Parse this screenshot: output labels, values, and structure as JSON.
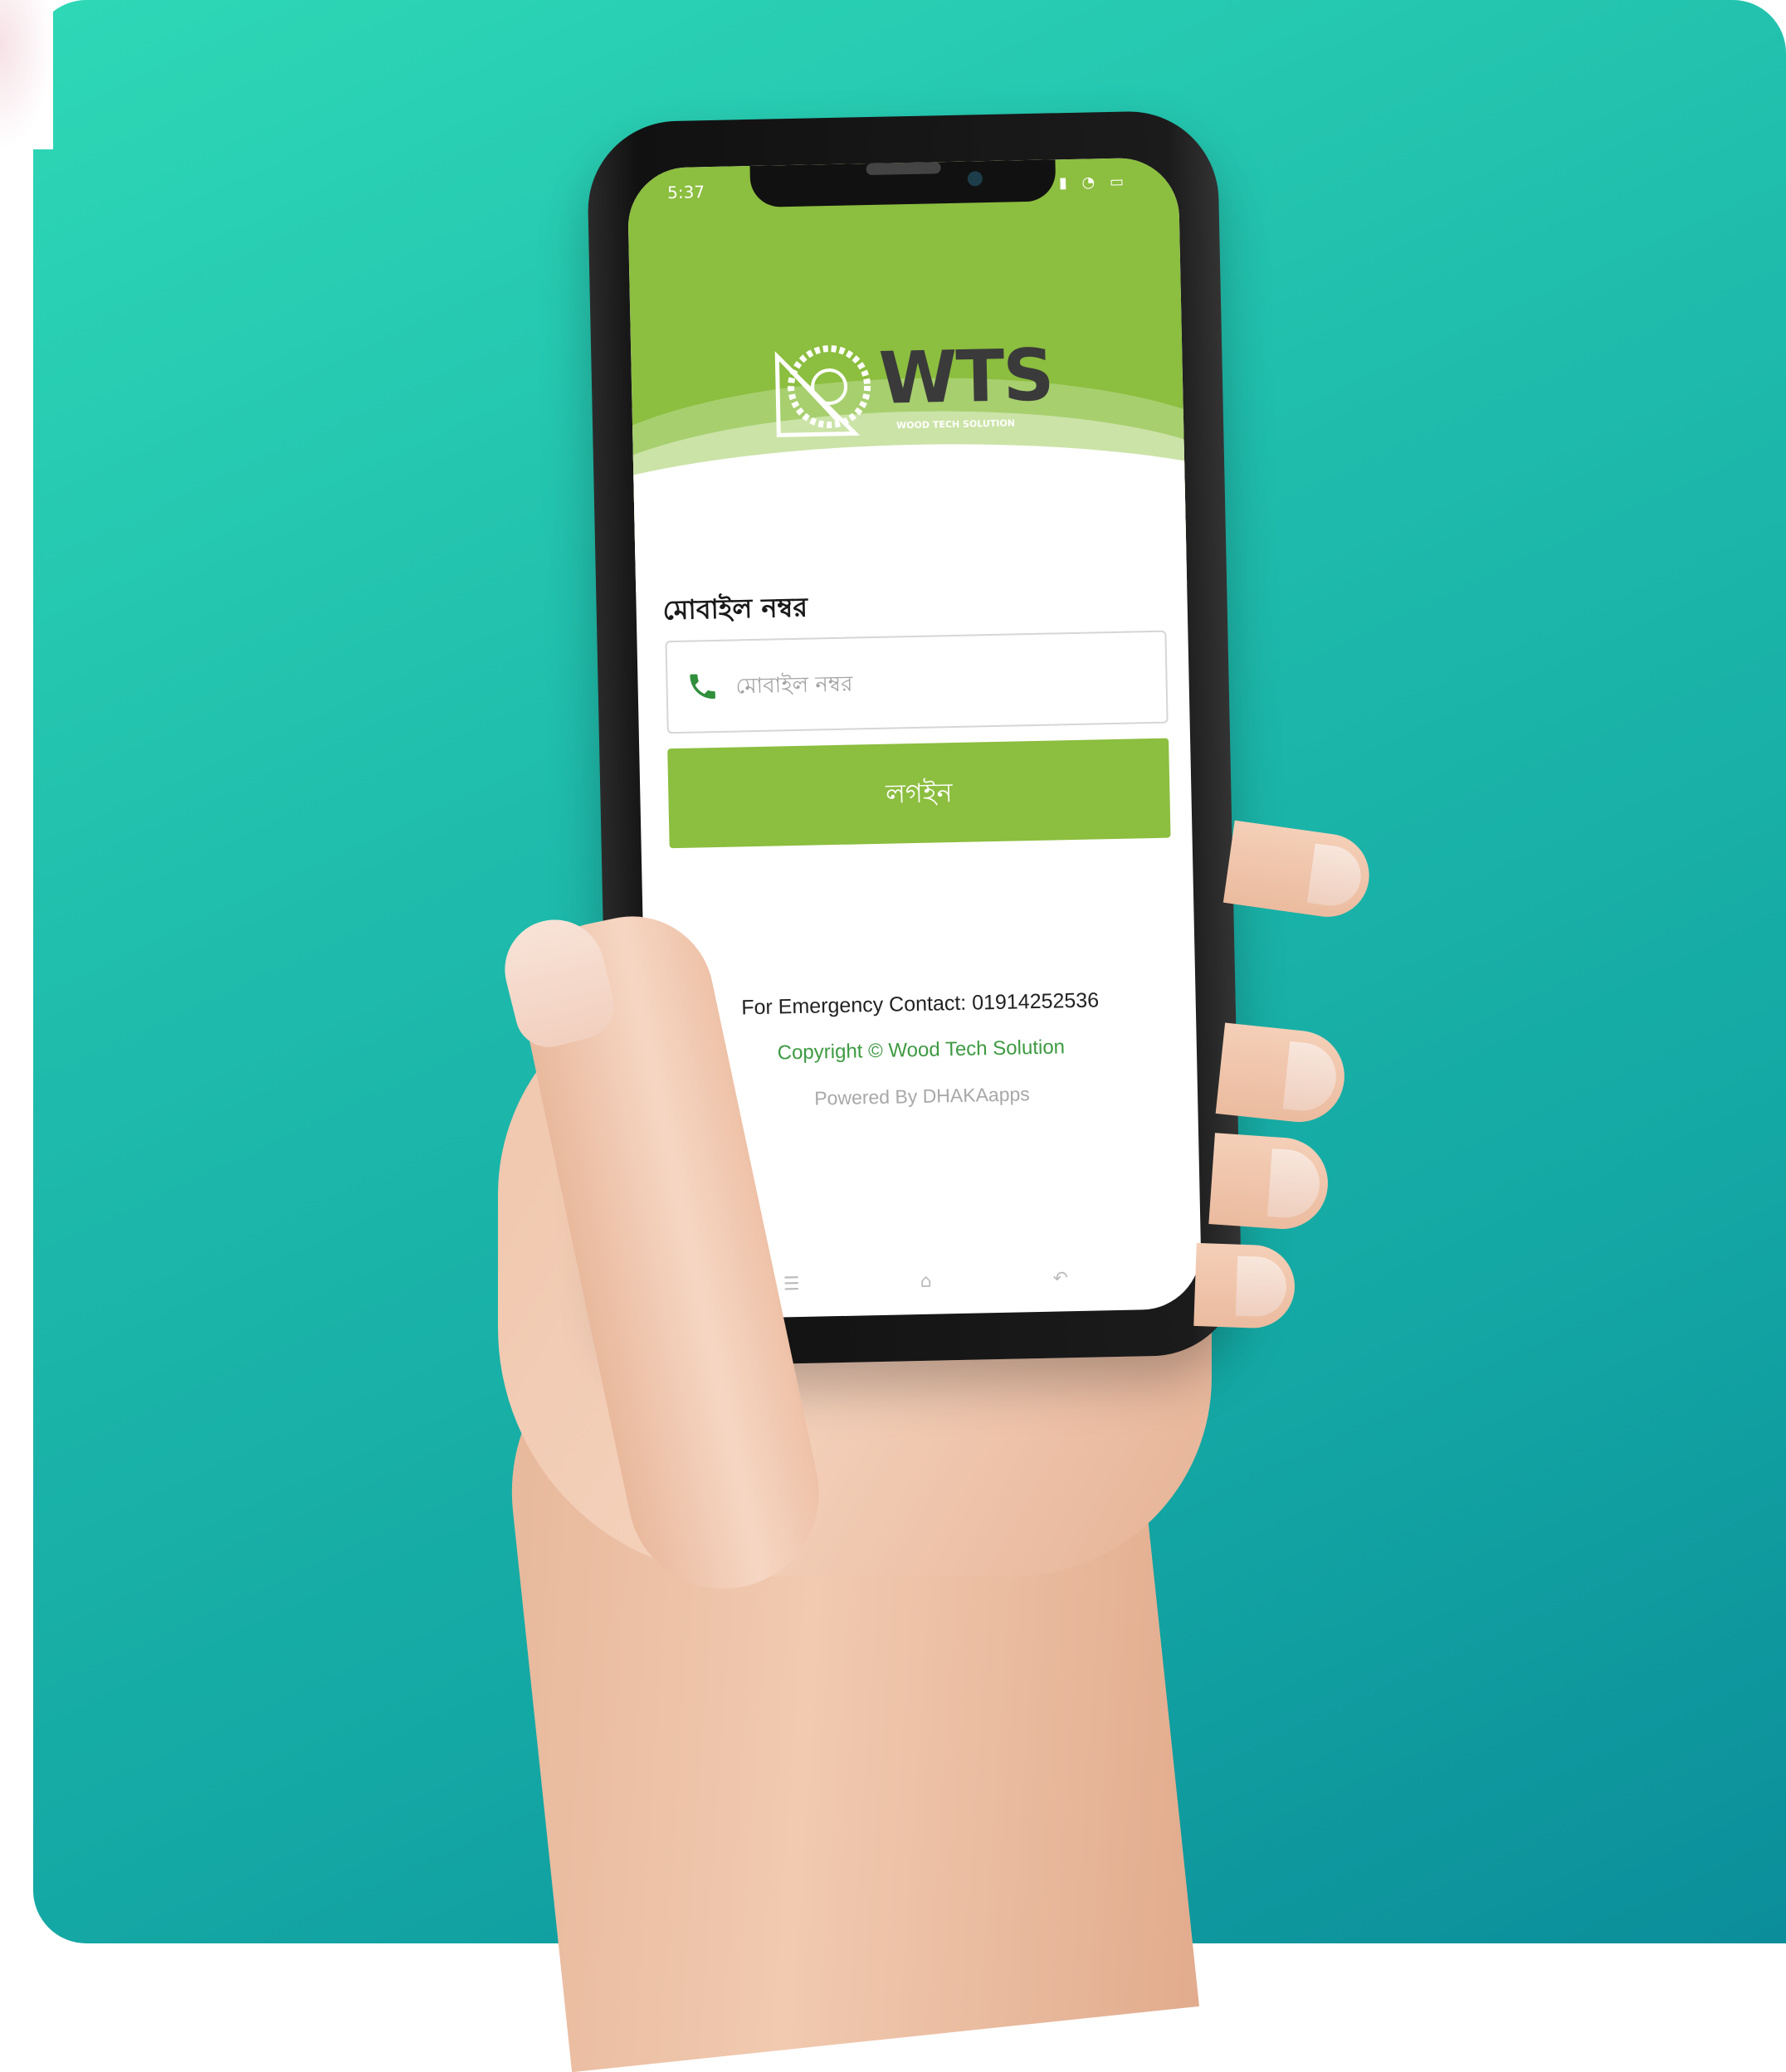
{
  "status_bar": {
    "time": "5:37",
    "icons": [
      "signal-icon",
      "wifi-icon",
      "battery-icon"
    ]
  },
  "logo": {
    "text": "WTS",
    "subtitle": "WOOD TECH SOLUTION"
  },
  "form": {
    "label": "মোবাইল নম্বর",
    "input_placeholder": "মোবাইল নম্বর",
    "input_value": "",
    "login_label": "লগইন"
  },
  "footer": {
    "emergency": "For Emergency  Contact: 01914252536",
    "copyright": "Copyright © Wood Tech Solution",
    "powered": "Powered By DHAKAapps"
  },
  "colors": {
    "brand_green": "#8cbe3f",
    "accent_green": "#3d9a41",
    "background_teal": "#1fbcac"
  }
}
